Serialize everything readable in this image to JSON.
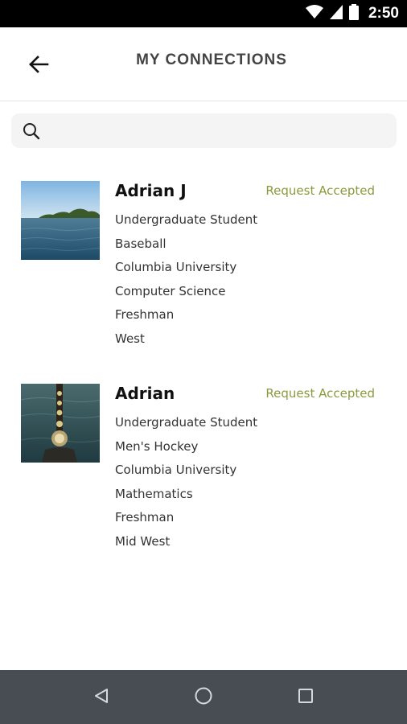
{
  "status_bar": {
    "time": "2:50",
    "icons": [
      "wifi-icon",
      "cellular-signal-icon",
      "battery-icon"
    ]
  },
  "header": {
    "title": "MY CONNECTIONS",
    "back_icon": "back-arrow-icon"
  },
  "search": {
    "icon": "search-icon",
    "value": "",
    "placeholder": ""
  },
  "connections": [
    {
      "name": "Adrian J",
      "status": "Request Accepted",
      "details": [
        "Undergraduate Student",
        "Baseball",
        "Columbia University",
        "Computer Science",
        "Freshman",
        "West"
      ]
    },
    {
      "name": "Adrian",
      "status": "Request Accepted",
      "details": [
        "Undergraduate Student",
        "Men's Hockey",
        "Columbia University",
        "Mathematics",
        "Freshman",
        "Mid West"
      ]
    }
  ],
  "nav_bar": {
    "icons": [
      "nav-back-icon",
      "nav-home-icon",
      "nav-recents-icon"
    ]
  },
  "colors": {
    "status_accent": "#8a9a3c",
    "nav_bar_bg": "#474d52",
    "status_bar_bg": "#000000"
  }
}
